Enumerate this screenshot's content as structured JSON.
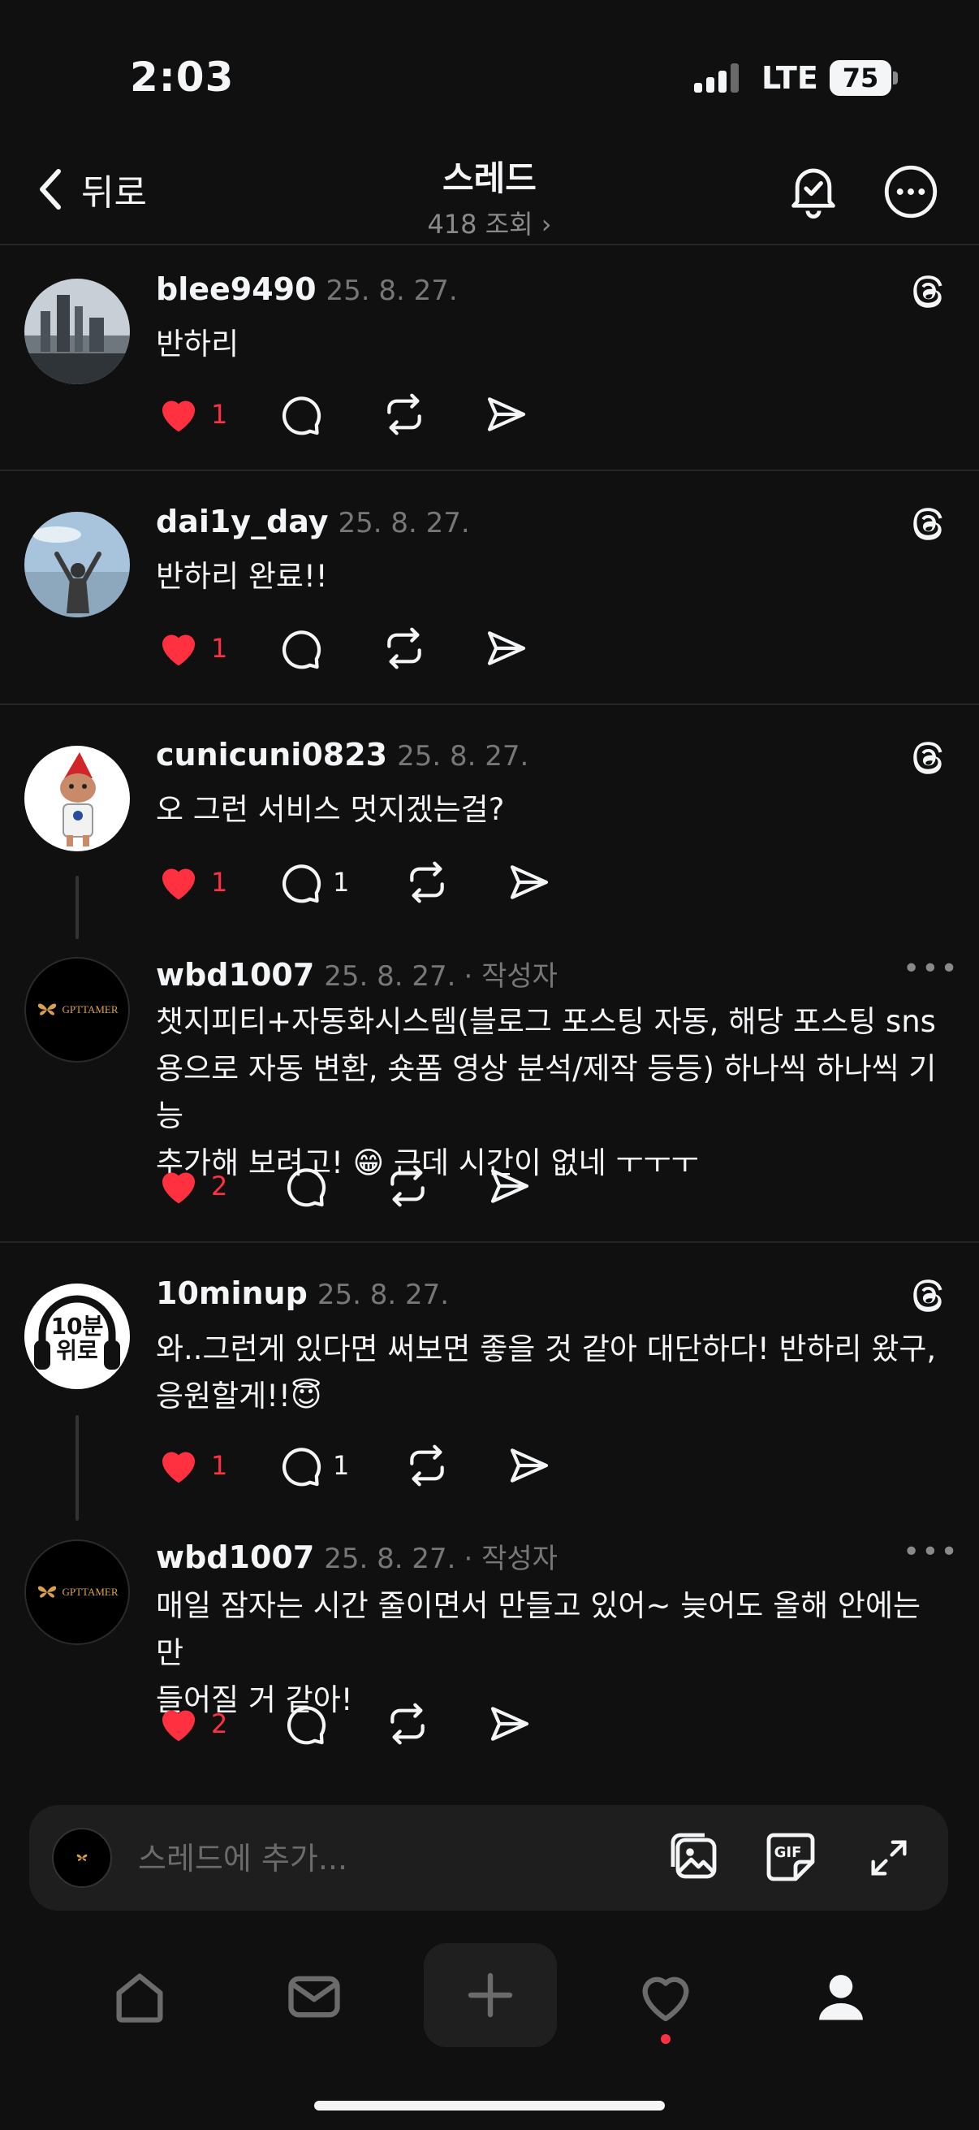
{
  "status_bar": {
    "time": "2:03",
    "network": "LTE",
    "battery": "75"
  },
  "header": {
    "back_label": "뒤로",
    "title": "스레드",
    "views": "418 조회 ›"
  },
  "posts": [
    {
      "username": "blee9490",
      "date": "25. 8. 27.",
      "text": [
        "반하리"
      ],
      "likes": "1",
      "replies": ""
    },
    {
      "username": "dai1y_day",
      "date": "25. 8. 27.",
      "text": [
        "반하리 완료!!"
      ],
      "likes": "1",
      "replies": ""
    },
    {
      "username": "cunicuni0823",
      "date": "25. 8. 27.",
      "text": [
        "오 그런 서비스 멋지겠는걸?"
      ],
      "likes": "1",
      "replies": "1"
    },
    {
      "username": "wbd1007",
      "date": "25. 8. 27.",
      "author_tag": "· 작성자",
      "text": [
        "챗지피티+자동화시스템(블로그 포스팅 자동, 해당 포스팅 sns",
        "용으로 자동 변환, 숏폼 영상 분석/제작 등등) 하나씩 하나씩 기능",
        "추가해 보려고! 😁 근데 시간이 없네 ㅜㅜㅜ"
      ],
      "likes": "2",
      "replies": ""
    },
    {
      "username": "10minup",
      "date": "25. 8. 27.",
      "avatar_text": [
        "10분",
        "위로"
      ],
      "text": [
        "와..그런게 있다면 써보면 좋을 것 같아 대단하다! 반하리 왔구,",
        "응원할게!!😇"
      ],
      "likes": "1",
      "replies": "1"
    },
    {
      "username": "wbd1007",
      "date": "25. 8. 27.",
      "author_tag": "· 작성자",
      "text": [
        "매일 잠자는 시간 줄이면서 만들고 있어~ 늦어도 올해 안에는 만",
        "들어질 거 같아!"
      ],
      "likes": "2",
      "replies": ""
    }
  ],
  "logo_text": "GPTTAMER",
  "composer": {
    "placeholder": "스레드에 추가..."
  },
  "colors": {
    "background": "#101010",
    "like_red": "#ff3040",
    "muted": "#777777",
    "divider": "#262626"
  },
  "icons": {
    "like": "heart-icon",
    "reply": "comment-icon",
    "repost": "repost-icon",
    "share": "send-icon",
    "threads": "threads-logo-icon"
  }
}
